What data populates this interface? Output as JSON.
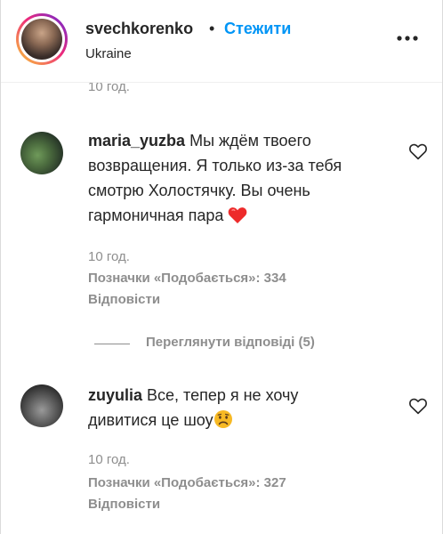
{
  "header": {
    "username": "svechkorenko",
    "separator": "•",
    "follow_label": "Стежити",
    "location": "Ukraine",
    "more_icon": "more-horizontal-icon"
  },
  "partial_comment": {
    "time": "10 год."
  },
  "comments": [
    {
      "username": "maria_yuzba",
      "text_lines": [
        "Мы ждём твоего",
        "возвращения. Я только из-за тебя",
        "смотрю Холостячку. Вы очень",
        "гармоничная пара"
      ],
      "text_continuation": [
        "возвращения. Я только из-за тебя",
        "смотрю Холостячку. Вы очень",
        "гармоничная пара"
      ],
      "emoji": "red-heart-emoji",
      "time": "10 год.",
      "likes": "Позначки «Подобається»: 334",
      "reply": "Відповісти",
      "view_replies": "Переглянути відповіді (5)"
    },
    {
      "username": "zuyulia",
      "first_line": "Все, тепер я не хочу",
      "second_line": "дивитися це шоу",
      "emoji": "sad-face-emoji",
      "time": "10 год.",
      "likes": "Позначки «Подобається»: 327",
      "reply": "Відповісти"
    }
  ],
  "colors": {
    "link": "#0095f6",
    "text": "#262626",
    "secondary": "#8e8e8e",
    "heart": "#ed2b2b",
    "emoji_face": "#f7b924"
  }
}
